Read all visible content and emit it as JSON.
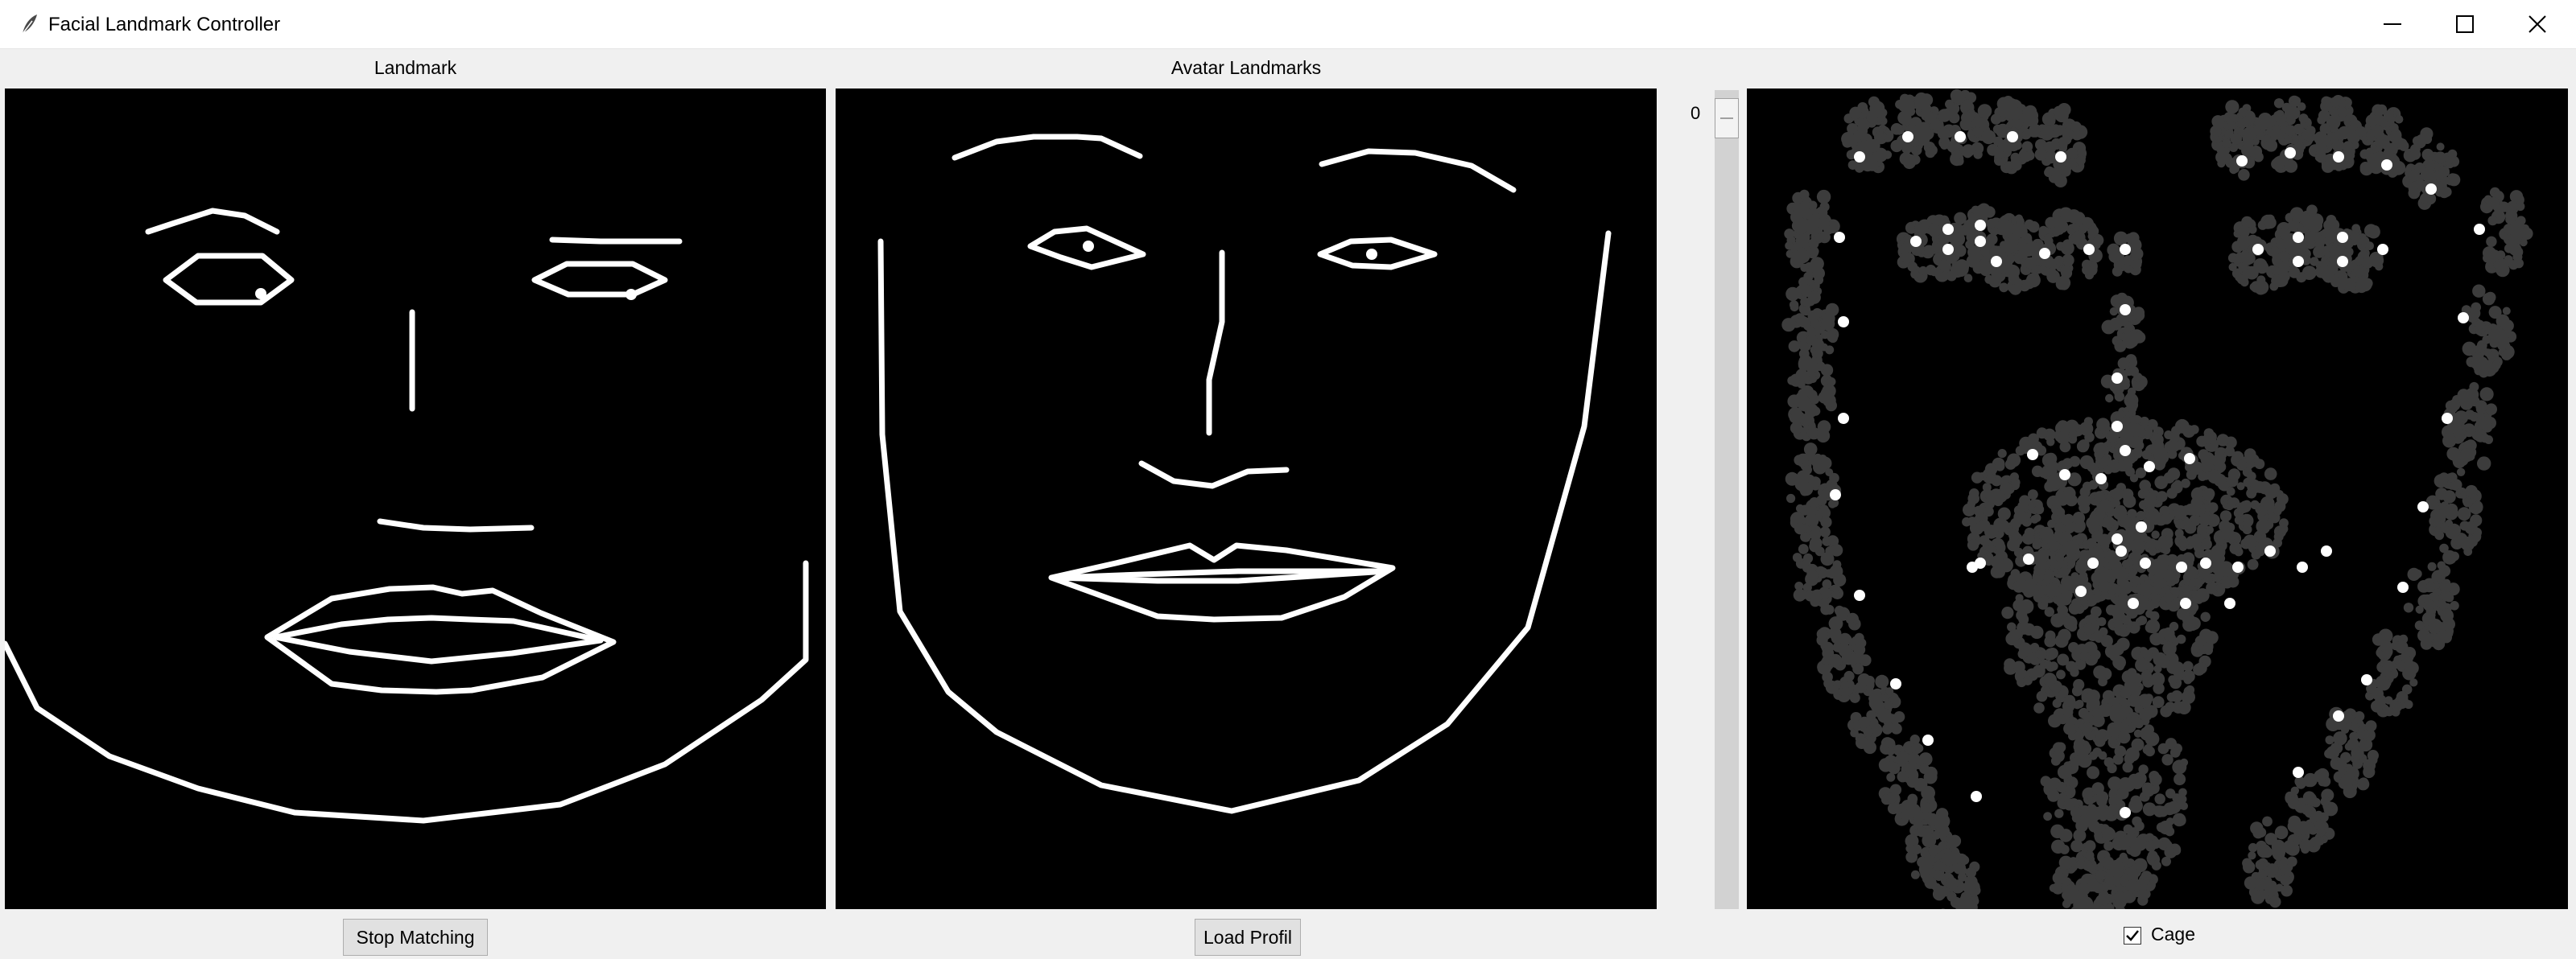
{
  "window": {
    "title": "Facial Landmark Controller",
    "controls": [
      "minimize-icon",
      "maximize-icon",
      "close-icon"
    ]
  },
  "panels": {
    "landmark_label": "Landmark",
    "avatar_label": "Avatar Landmarks"
  },
  "scale": {
    "value": "0"
  },
  "buttons": {
    "stop_matching": "Stop Matching",
    "load_profil": "Load Profil"
  },
  "cage": {
    "label": "Cage",
    "checked": true
  },
  "colors": {
    "canvas_bg": "#000000",
    "lines": "#ffffff",
    "cloud": "#3c3c3c"
  }
}
